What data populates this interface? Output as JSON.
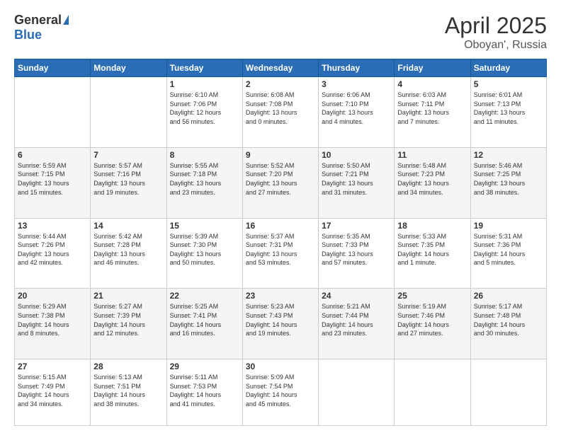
{
  "logo": {
    "general": "General",
    "blue": "Blue"
  },
  "title": {
    "month": "April 2025",
    "location": "Oboyan', Russia"
  },
  "days_of_week": [
    "Sunday",
    "Monday",
    "Tuesday",
    "Wednesday",
    "Thursday",
    "Friday",
    "Saturday"
  ],
  "weeks": [
    [
      {
        "num": "",
        "info": ""
      },
      {
        "num": "",
        "info": ""
      },
      {
        "num": "1",
        "info": "Sunrise: 6:10 AM\nSunset: 7:06 PM\nDaylight: 12 hours\nand 56 minutes."
      },
      {
        "num": "2",
        "info": "Sunrise: 6:08 AM\nSunset: 7:08 PM\nDaylight: 13 hours\nand 0 minutes."
      },
      {
        "num": "3",
        "info": "Sunrise: 6:06 AM\nSunset: 7:10 PM\nDaylight: 13 hours\nand 4 minutes."
      },
      {
        "num": "4",
        "info": "Sunrise: 6:03 AM\nSunset: 7:11 PM\nDaylight: 13 hours\nand 7 minutes."
      },
      {
        "num": "5",
        "info": "Sunrise: 6:01 AM\nSunset: 7:13 PM\nDaylight: 13 hours\nand 11 minutes."
      }
    ],
    [
      {
        "num": "6",
        "info": "Sunrise: 5:59 AM\nSunset: 7:15 PM\nDaylight: 13 hours\nand 15 minutes."
      },
      {
        "num": "7",
        "info": "Sunrise: 5:57 AM\nSunset: 7:16 PM\nDaylight: 13 hours\nand 19 minutes."
      },
      {
        "num": "8",
        "info": "Sunrise: 5:55 AM\nSunset: 7:18 PM\nDaylight: 13 hours\nand 23 minutes."
      },
      {
        "num": "9",
        "info": "Sunrise: 5:52 AM\nSunset: 7:20 PM\nDaylight: 13 hours\nand 27 minutes."
      },
      {
        "num": "10",
        "info": "Sunrise: 5:50 AM\nSunset: 7:21 PM\nDaylight: 13 hours\nand 31 minutes."
      },
      {
        "num": "11",
        "info": "Sunrise: 5:48 AM\nSunset: 7:23 PM\nDaylight: 13 hours\nand 34 minutes."
      },
      {
        "num": "12",
        "info": "Sunrise: 5:46 AM\nSunset: 7:25 PM\nDaylight: 13 hours\nand 38 minutes."
      }
    ],
    [
      {
        "num": "13",
        "info": "Sunrise: 5:44 AM\nSunset: 7:26 PM\nDaylight: 13 hours\nand 42 minutes."
      },
      {
        "num": "14",
        "info": "Sunrise: 5:42 AM\nSunset: 7:28 PM\nDaylight: 13 hours\nand 46 minutes."
      },
      {
        "num": "15",
        "info": "Sunrise: 5:39 AM\nSunset: 7:30 PM\nDaylight: 13 hours\nand 50 minutes."
      },
      {
        "num": "16",
        "info": "Sunrise: 5:37 AM\nSunset: 7:31 PM\nDaylight: 13 hours\nand 53 minutes."
      },
      {
        "num": "17",
        "info": "Sunrise: 5:35 AM\nSunset: 7:33 PM\nDaylight: 13 hours\nand 57 minutes."
      },
      {
        "num": "18",
        "info": "Sunrise: 5:33 AM\nSunset: 7:35 PM\nDaylight: 14 hours\nand 1 minute."
      },
      {
        "num": "19",
        "info": "Sunrise: 5:31 AM\nSunset: 7:36 PM\nDaylight: 14 hours\nand 5 minutes."
      }
    ],
    [
      {
        "num": "20",
        "info": "Sunrise: 5:29 AM\nSunset: 7:38 PM\nDaylight: 14 hours\nand 8 minutes."
      },
      {
        "num": "21",
        "info": "Sunrise: 5:27 AM\nSunset: 7:39 PM\nDaylight: 14 hours\nand 12 minutes."
      },
      {
        "num": "22",
        "info": "Sunrise: 5:25 AM\nSunset: 7:41 PM\nDaylight: 14 hours\nand 16 minutes."
      },
      {
        "num": "23",
        "info": "Sunrise: 5:23 AM\nSunset: 7:43 PM\nDaylight: 14 hours\nand 19 minutes."
      },
      {
        "num": "24",
        "info": "Sunrise: 5:21 AM\nSunset: 7:44 PM\nDaylight: 14 hours\nand 23 minutes."
      },
      {
        "num": "25",
        "info": "Sunrise: 5:19 AM\nSunset: 7:46 PM\nDaylight: 14 hours\nand 27 minutes."
      },
      {
        "num": "26",
        "info": "Sunrise: 5:17 AM\nSunset: 7:48 PM\nDaylight: 14 hours\nand 30 minutes."
      }
    ],
    [
      {
        "num": "27",
        "info": "Sunrise: 5:15 AM\nSunset: 7:49 PM\nDaylight: 14 hours\nand 34 minutes."
      },
      {
        "num": "28",
        "info": "Sunrise: 5:13 AM\nSunset: 7:51 PM\nDaylight: 14 hours\nand 38 minutes."
      },
      {
        "num": "29",
        "info": "Sunrise: 5:11 AM\nSunset: 7:53 PM\nDaylight: 14 hours\nand 41 minutes."
      },
      {
        "num": "30",
        "info": "Sunrise: 5:09 AM\nSunset: 7:54 PM\nDaylight: 14 hours\nand 45 minutes."
      },
      {
        "num": "",
        "info": ""
      },
      {
        "num": "",
        "info": ""
      },
      {
        "num": "",
        "info": ""
      }
    ]
  ]
}
